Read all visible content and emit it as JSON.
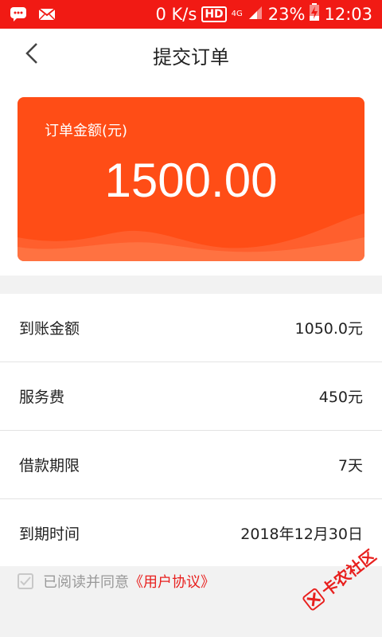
{
  "status_bar": {
    "speed": "0 K/s",
    "hd": "HD",
    "network": "4G",
    "battery": "23%",
    "time": "12:03"
  },
  "header": {
    "title": "提交订单"
  },
  "order_card": {
    "label": "订单金额(元)",
    "amount": "1500.00"
  },
  "details": [
    {
      "label": "到账金额",
      "value": "1050.0元"
    },
    {
      "label": "服务费",
      "value": "450元"
    },
    {
      "label": "借款期限",
      "value": "7天"
    },
    {
      "label": "到期时间",
      "value": "2018年12月30日"
    }
  ],
  "agreement": {
    "text": "已阅读并同意",
    "link": "《用户协议》"
  },
  "watermark": {
    "text": "卡农社区"
  },
  "colors": {
    "status_bar": "#f11a14",
    "card": "#ff4d16",
    "link": "#e8201e"
  }
}
